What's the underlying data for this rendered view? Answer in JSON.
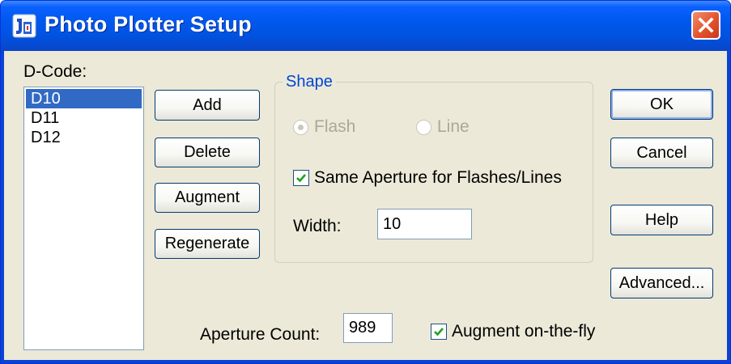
{
  "window": {
    "title": "Photo Plotter Setup"
  },
  "dcode": {
    "label": "D-Code:",
    "items": [
      "D10",
      "D11",
      "D12"
    ],
    "selected": "D10"
  },
  "actions": {
    "add": "Add",
    "delete": "Delete",
    "augment": "Augment",
    "regenerate": "Regenerate"
  },
  "shape": {
    "legend": "Shape",
    "flash_label": "Flash",
    "line_label": "Line",
    "flash_selected": true,
    "line_selected": false,
    "same_aperture_label": "Same Aperture for Flashes/Lines",
    "same_aperture_checked": true,
    "width_label": "Width:",
    "width_value": "10"
  },
  "aperture_count": {
    "label": "Aperture Count:",
    "value": "989"
  },
  "augment_on_the_fly": {
    "label": "Augment on-the-fly",
    "checked": true
  },
  "dialog_buttons": {
    "ok": "OK",
    "cancel": "Cancel",
    "help": "Help",
    "advanced": "Advanced..."
  },
  "colors": {
    "titlebar": "#0058ee",
    "dialog_bg": "#ece9d8",
    "selection": "#316ac5",
    "group_legend": "#0046d5",
    "checkmark": "#21a121",
    "close_button": "#e2542c"
  }
}
